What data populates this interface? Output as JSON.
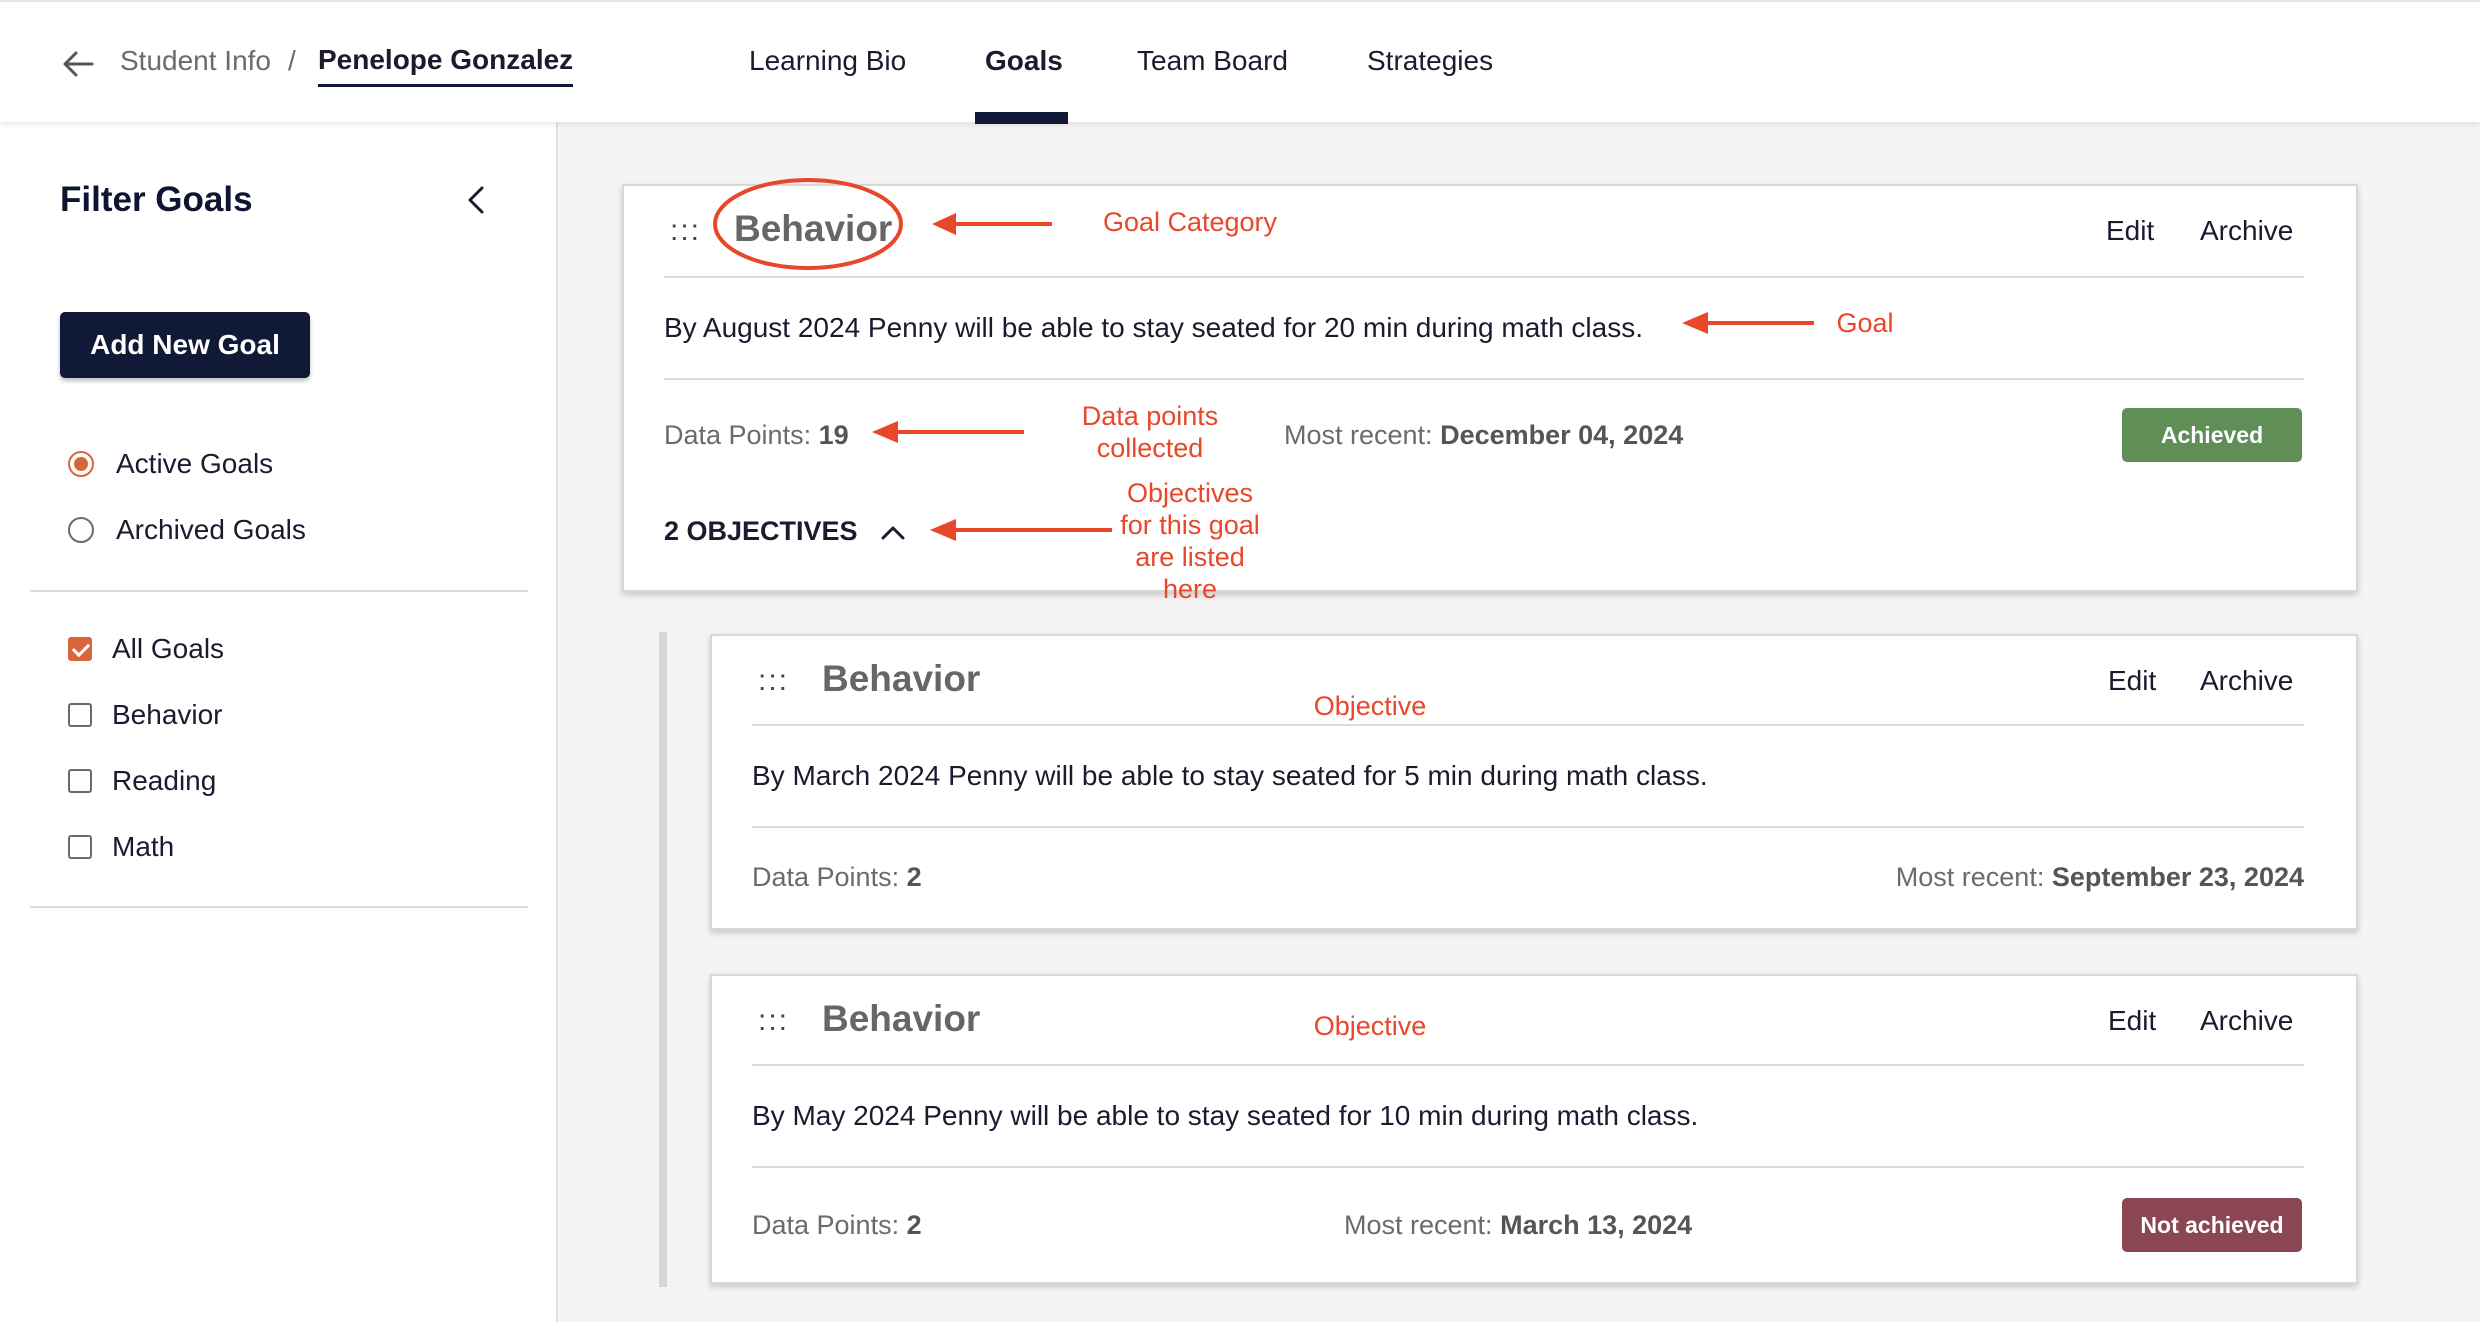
{
  "header": {
    "breadcrumb_parent": "Student Info",
    "breadcrumb_sep": "/",
    "breadcrumb_current": "Penelope Gonzalez",
    "tabs": [
      {
        "label": "Learning Bio"
      },
      {
        "label": "Goals",
        "active": true
      },
      {
        "label": "Team Board"
      },
      {
        "label": "Strategies"
      }
    ]
  },
  "sidebar": {
    "title": "Filter Goals",
    "add_button": "Add New Goal",
    "status_filters": [
      {
        "label": "Active Goals",
        "selected": true
      },
      {
        "label": "Archived Goals",
        "selected": false
      }
    ],
    "category_filters": [
      {
        "label": "All Goals",
        "checked": true
      },
      {
        "label": "Behavior",
        "checked": false
      },
      {
        "label": "Reading",
        "checked": false
      },
      {
        "label": "Math",
        "checked": false
      }
    ]
  },
  "goal": {
    "category": "Behavior",
    "edit": "Edit",
    "archive": "Archive",
    "text": "By August 2024 Penny will be able to stay seated for 20 min during math class.",
    "data_points_label": "Data Points:",
    "data_points": "19",
    "most_recent_label": "Most recent:",
    "most_recent": "December 04, 2024",
    "status": "Achieved",
    "objectives_toggle": "2 OBJECTIVES"
  },
  "objectives": [
    {
      "category": "Behavior",
      "edit": "Edit",
      "archive": "Archive",
      "text": "By March 2024 Penny will be able to stay seated for 5 min during math class.",
      "data_points_label": "Data Points:",
      "data_points": "2",
      "most_recent_label": "Most recent:",
      "most_recent": "September 23, 2024"
    },
    {
      "category": "Behavior",
      "edit": "Edit",
      "archive": "Archive",
      "text": "By May 2024 Penny will be able to stay seated for 10 min during math class.",
      "data_points_label": "Data Points:",
      "data_points": "2",
      "most_recent_label": "Most recent:",
      "most_recent": "March 13, 2024",
      "status": "Not achieved"
    }
  ],
  "annotations": {
    "goal_category": "Goal Category",
    "goal": "Goal",
    "data_points_line1": "Data points",
    "data_points_line2": "collected",
    "objectives_line1": "Objectives",
    "objectives_line2": "for this goal",
    "objectives_line3": "are listed",
    "objectives_line4": "here",
    "objective_1": "Objective",
    "objective_2": "Objective"
  },
  "colors": {
    "navy": "#101935",
    "accent_orange": "#d9653a",
    "achieved_green": "#5f8f57",
    "not_achieved_maroon": "#8b4653",
    "annotation_red": "#e8472a"
  },
  "icons": {
    "back": "arrow-left-icon",
    "collapse": "chevron-left-icon",
    "drag": "drag-handle-icon",
    "expand": "chevron-up-icon"
  }
}
